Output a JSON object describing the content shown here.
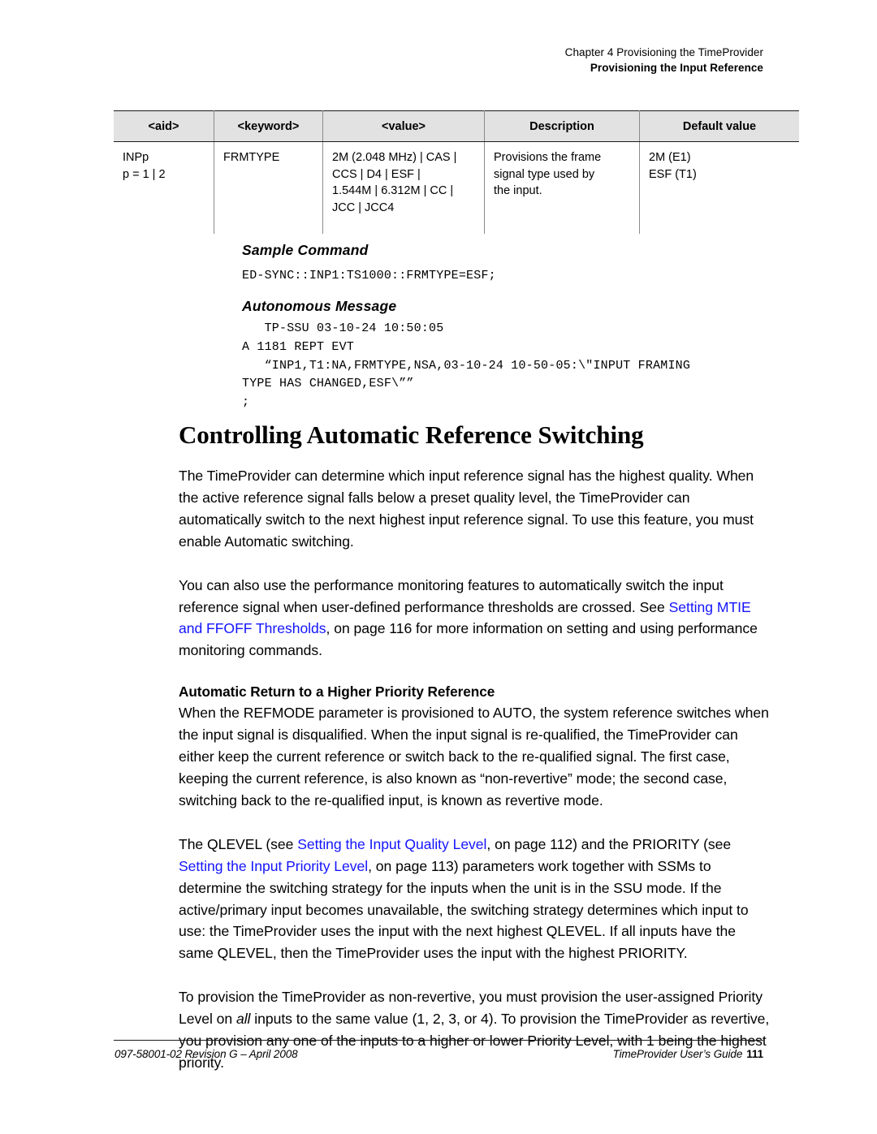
{
  "running_header": {
    "chapter_line": "Chapter 4 Provisioning the TimeProvider",
    "section_line": "Provisioning the Input Reference"
  },
  "param_table": {
    "headers": [
      "<aid>",
      "<keyword>",
      "<value>",
      "Description",
      "Default value"
    ],
    "rows": [
      {
        "aid": "INPp\np = 1 | 2",
        "keyword": "FRMTYPE",
        "value": "2M (2.048 MHz) | CAS |\nCCS | D4 | ESF |\n1.544M | 6.312M | CC |\nJCC | JCC4",
        "description": "Provisions the frame\nsignal type used by\nthe input.",
        "default_value": "2M (E1)\nESF (T1)"
      }
    ]
  },
  "sample_command": {
    "heading": "Sample Command",
    "code": "ED-SYNC::INP1:TS1000::FRMTYPE=ESF;"
  },
  "autonomous_message": {
    "heading": "Autonomous Message",
    "code": "   TP-SSU 03-10-24 10:50:05\nA 1181 REPT EVT\n   “INP1,T1:NA,FRMTYPE,NSA,03-10-24 10-50-05:\\\"INPUT FRAMING\nTYPE HAS CHANGED,ESF\\””\n;"
  },
  "main_heading": "Controlling Automatic Reference Switching",
  "paragraphs": {
    "p1": "The TimeProvider can determine which input reference signal has the highest quality. When the active reference signal falls below a preset quality level, the TimeProvider can automatically switch to the next highest input reference signal. To use this feature, you must enable Automatic switching.",
    "p2_before": "You can also use the performance monitoring features to automatically switch the input reference signal when user-defined performance thresholds are crossed. See ",
    "p2_link": "Setting MTIE and FFOFF Thresholds",
    "p2_after": ", on page 116 for more information on setting and using performance monitoring commands.",
    "subheading": "Automatic Return to a Higher Priority Reference",
    "p3": "When the REFMODE parameter is provisioned to AUTO, the system reference switches when the input signal is disqualified. When the input signal is re-qualified, the TimeProvider can either keep the current reference or switch back to the re-qualified signal. The first case, keeping the current reference, is also known as “non-revertive” mode; the second case, switching back to the re-qualified input, is known as revertive mode.",
    "p4_seg1": "The QLEVEL (see ",
    "p4_link1": "Setting the Input Quality Level",
    "p4_seg2": ", on page 112) and the PRIORITY (see ",
    "p4_link2": "Setting the Input Priority Level",
    "p4_seg3": ", on page 113) parameters work together with SSMs to determine the switching strategy for the inputs when the unit is in the SSU mode. If the active/primary input becomes unavailable, the switching strategy determines which input to use: the TimeProvider uses the input with the next highest QLEVEL. If all inputs have the same QLEVEL, then the TimeProvider uses the input with the highest PRIORITY.",
    "p5_seg1": "To provision the TimeProvider as non-revertive, you must provision the user-assigned Priority Level on ",
    "p5_ital": "all",
    "p5_seg2": " inputs to the same value (1, 2, 3, or 4). To provision the TimeProvider as revertive, you provision any one of the inputs to a higher or lower Priority Level, with 1 being the highest priority."
  },
  "footer": {
    "left": "097-58001-02 Revision G – April 2008",
    "right": "TimeProvider User’s Guide",
    "page_number": "111"
  },
  "colors": {
    "link": "#1414ff",
    "table_header_bg": "#e2e2e2",
    "rule": "#1a1a1a"
  }
}
